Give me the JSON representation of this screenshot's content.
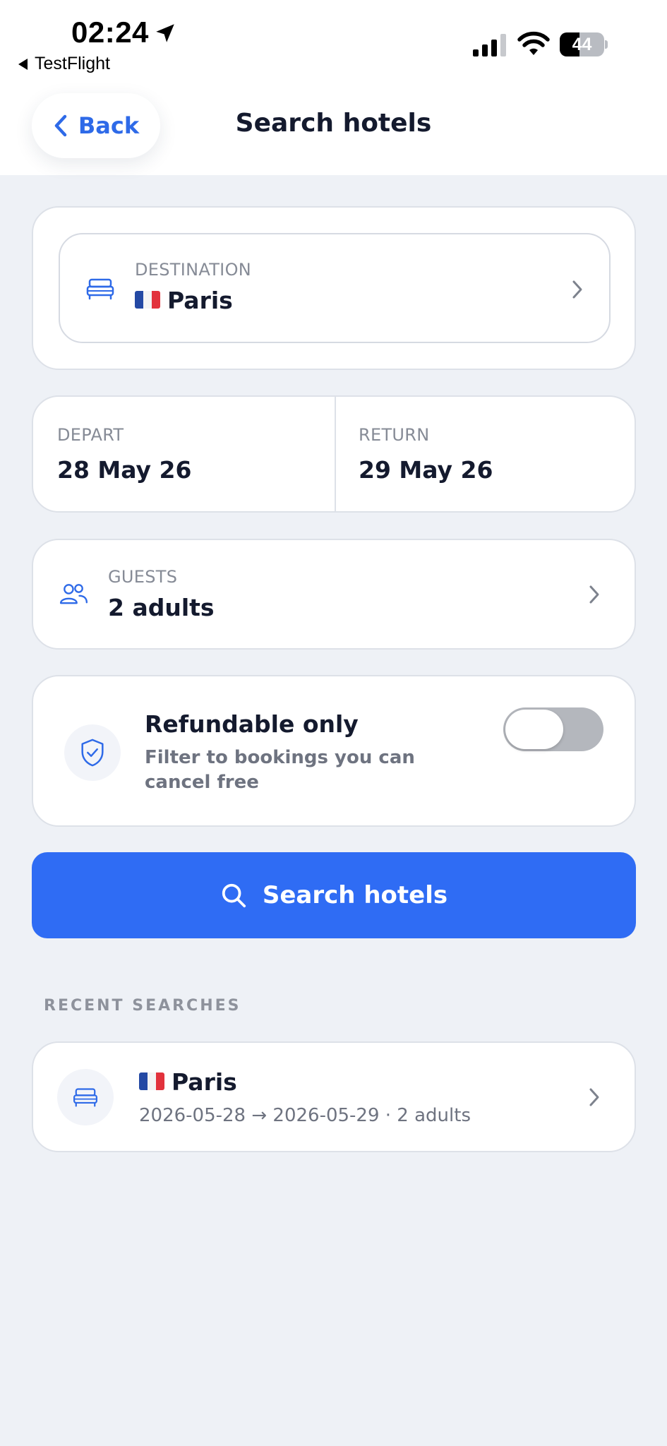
{
  "status_bar": {
    "time": "02:24",
    "back_app": "TestFlight",
    "battery": "44",
    "battery_level": 0.44
  },
  "nav": {
    "back_label": "Back",
    "title": "Search hotels"
  },
  "destination": {
    "label": "DESTINATION",
    "flag": "france-flag",
    "value": "Paris"
  },
  "dates": {
    "depart_label": "DEPART",
    "depart_value": "28 May 26",
    "return_label": "RETURN",
    "return_value": "29 May 26"
  },
  "guests": {
    "label": "GUESTS",
    "value": "2 adults"
  },
  "refundable": {
    "title": "Refundable only",
    "description": "Filter to bookings you can cancel free",
    "enabled": false
  },
  "search_button": {
    "label": "Search hotels"
  },
  "recent": {
    "section_title": "RECENT SEARCHES",
    "items": [
      {
        "flag": "france-flag",
        "city": "Paris",
        "details": "2026-05-28 → 2026-05-29 · 2 adults"
      }
    ]
  },
  "colors": {
    "accent": "#2f6cf4",
    "background": "#eef1f6",
    "text": "#141a2e",
    "muted": "#868b96"
  }
}
